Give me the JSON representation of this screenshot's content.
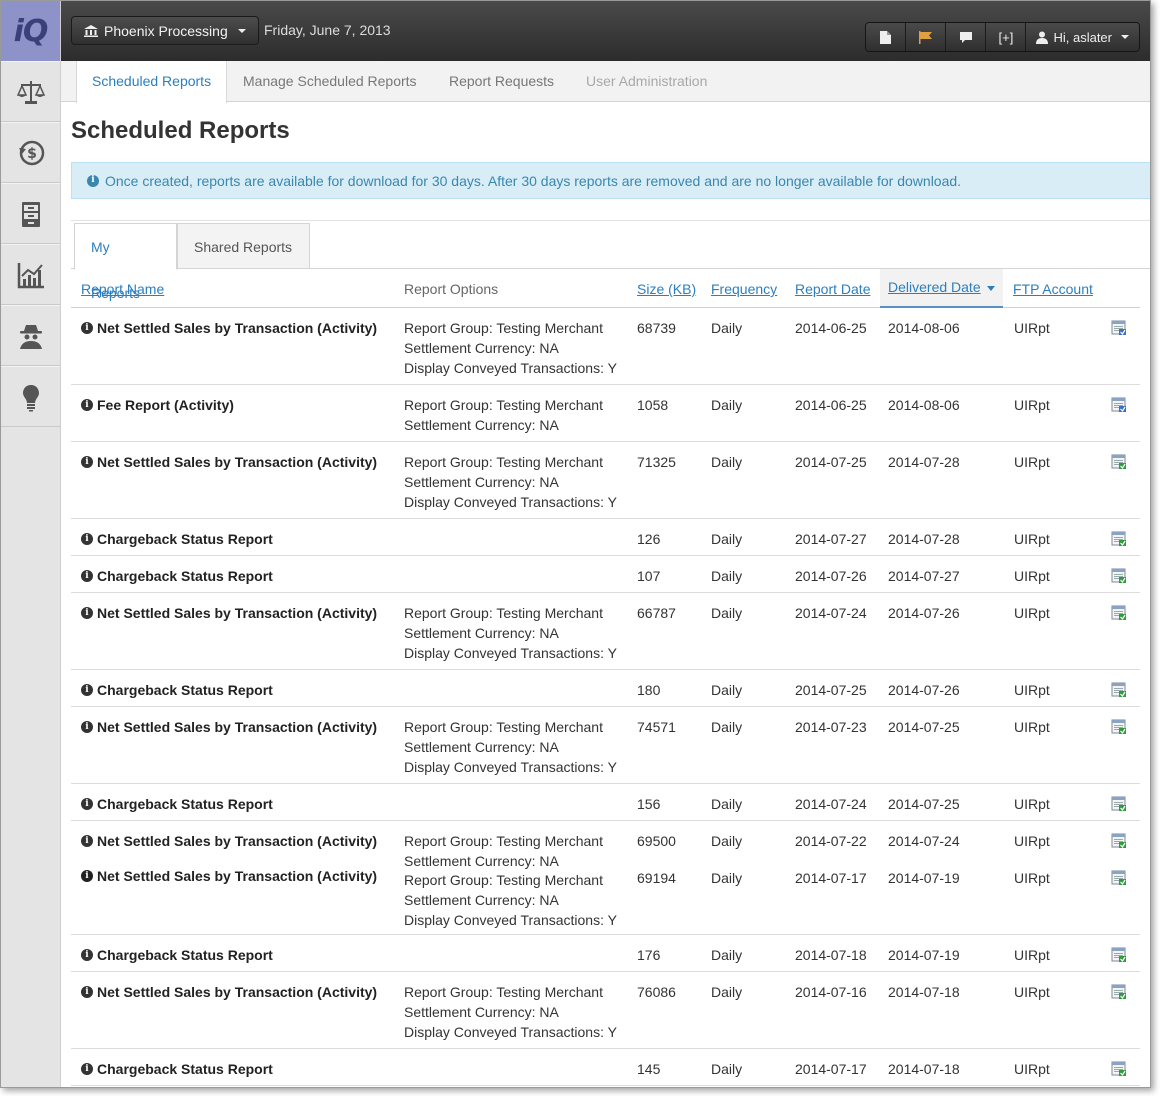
{
  "app": {
    "logo_text": "iQ"
  },
  "sidebar": {
    "items": [
      {
        "icon": "scales-icon"
      },
      {
        "icon": "refund-dollar-icon"
      },
      {
        "icon": "file-cabinet-icon"
      },
      {
        "icon": "line-chart-icon"
      },
      {
        "icon": "spy-icon"
      },
      {
        "icon": "lightbulb-icon"
      }
    ]
  },
  "topbar": {
    "merchant": "Phoenix Processing",
    "date": "Friday, June 7, 2013",
    "expand_label": "[+]",
    "user_greeting": "Hi, aslater"
  },
  "nav": {
    "tabs": [
      {
        "label": "Scheduled Reports",
        "state": "active"
      },
      {
        "label": "Manage Scheduled Reports",
        "state": "normal"
      },
      {
        "label": "Report Requests",
        "state": "normal"
      },
      {
        "label": "User Administration",
        "state": "disabled"
      }
    ]
  },
  "page": {
    "title": "Scheduled Reports",
    "alert": "Once created, reports are available for download for 30 days. After 30 days reports are removed and are no longer available for download."
  },
  "subtabs": {
    "my": "My Reports",
    "shared": "Shared Reports"
  },
  "table": {
    "headers": {
      "name": "Report Name",
      "options": "Report Options",
      "size": "Size (KB)",
      "frequency": "Frequency",
      "report_date": "Report Date",
      "delivered_date": "Delivered Date",
      "ftp": "FTP Account"
    },
    "rows": [
      {
        "name": "Net Settled Sales by Transaction (Activity)",
        "options": [
          "Report Group: Testing Merchant",
          "Settlement Currency: NA",
          "Display Conveyed Transactions: Y"
        ],
        "size": "68739",
        "frequency": "Daily",
        "report_date": "2014-06-25",
        "delivered_date": "2014-08-06",
        "ftp": "UIRpt",
        "file": "csv"
      },
      {
        "name": "Fee Report (Activity)",
        "options": [
          "Report Group: Testing Merchant",
          "Settlement Currency: NA"
        ],
        "size": "1058",
        "frequency": "Daily",
        "report_date": "2014-06-25",
        "delivered_date": "2014-08-06",
        "ftp": "UIRpt",
        "file": "csv"
      },
      {
        "name": "Net Settled Sales by Transaction (Activity)",
        "options": [
          "Report Group: Testing Merchant",
          "Settlement Currency: NA",
          "Display Conveyed Transactions: Y"
        ],
        "size": "71325",
        "frequency": "Daily",
        "report_date": "2014-07-25",
        "delivered_date": "2014-07-28",
        "ftp": "UIRpt",
        "file": "xls"
      },
      {
        "name": "Chargeback Status Report",
        "options": [],
        "size": "126",
        "frequency": "Daily",
        "report_date": "2014-07-27",
        "delivered_date": "2014-07-28",
        "ftp": "UIRpt",
        "file": "xls"
      },
      {
        "name": "Chargeback Status Report",
        "options": [],
        "size": "107",
        "frequency": "Daily",
        "report_date": "2014-07-26",
        "delivered_date": "2014-07-27",
        "ftp": "UIRpt",
        "file": "xls"
      },
      {
        "name": "Net Settled Sales by Transaction (Activity)",
        "options": [
          "Report Group: Testing Merchant",
          "Settlement Currency: NA",
          "Display Conveyed Transactions: Y"
        ],
        "size": "66787",
        "frequency": "Daily",
        "report_date": "2014-07-24",
        "delivered_date": "2014-07-26",
        "ftp": "UIRpt",
        "file": "xls"
      },
      {
        "name": "Chargeback Status Report",
        "options": [],
        "size": "180",
        "frequency": "Daily",
        "report_date": "2014-07-25",
        "delivered_date": "2014-07-26",
        "ftp": "UIRpt",
        "file": "xls"
      },
      {
        "name": "Net Settled Sales by Transaction (Activity)",
        "options": [
          "Report Group: Testing Merchant",
          "Settlement Currency: NA",
          "Display Conveyed Transactions: Y"
        ],
        "size": "74571",
        "frequency": "Daily",
        "report_date": "2014-07-23",
        "delivered_date": "2014-07-25",
        "ftp": "UIRpt",
        "file": "xls"
      },
      {
        "name": "Chargeback Status Report",
        "options": [],
        "size": "156",
        "frequency": "Daily",
        "report_date": "2014-07-24",
        "delivered_date": "2014-07-25",
        "ftp": "UIRpt",
        "file": "xls"
      },
      {
        "name": "Net Settled Sales by Transaction (Activity)",
        "options": [
          "Report Group: Testing Merchant",
          "Settlement Currency: NA"
        ],
        "size": "69500",
        "frequency": "Daily",
        "report_date": "2014-07-22",
        "delivered_date": "2014-07-24",
        "ftp": "UIRpt",
        "file": "xls",
        "sub": {
          "name": "Net Settled Sales by Transaction (Activity)",
          "options": [
            "Report Group: Testing Merchant",
            "Settlement Currency: NA",
            "Display Conveyed Transactions: Y"
          ],
          "size": "69194",
          "frequency": "Daily",
          "report_date": "2014-07-17",
          "delivered_date": "2014-07-19",
          "ftp": "UIRpt",
          "file": "xls"
        }
      },
      {
        "name": "Chargeback Status Report",
        "options": [],
        "size": "176",
        "frequency": "Daily",
        "report_date": "2014-07-18",
        "delivered_date": "2014-07-19",
        "ftp": "UIRpt",
        "file": "xls"
      },
      {
        "name": "Net Settled Sales by Transaction (Activity)",
        "options": [
          "Report Group: Testing Merchant",
          "Settlement Currency: NA",
          "Display Conveyed Transactions: Y"
        ],
        "size": "76086",
        "frequency": "Daily",
        "report_date": "2014-07-16",
        "delivered_date": "2014-07-18",
        "ftp": "UIRpt",
        "file": "xls"
      },
      {
        "name": "Chargeback Status Report",
        "options": [],
        "size": "145",
        "frequency": "Daily",
        "report_date": "2014-07-17",
        "delivered_date": "2014-07-18",
        "ftp": "UIRpt",
        "file": "xls"
      }
    ]
  }
}
